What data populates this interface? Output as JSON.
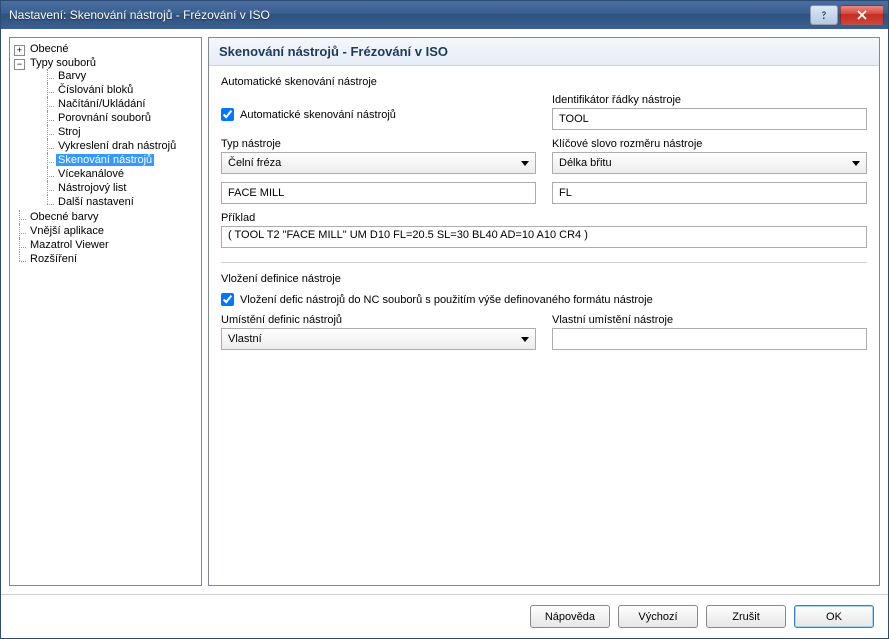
{
  "window": {
    "title": "Nastavení: Skenování nástrojů - Frézování v ISO"
  },
  "tree": {
    "obecne": "Obecné",
    "typy_souboru": "Typy souborů",
    "barvy": "Barvy",
    "cislovani": "Číslování bloků",
    "nacitani": "Načítání/Ukládání",
    "porovnani": "Porovnání souborů",
    "stroj": "Stroj",
    "vykresleni": "Vykreslení drah nástrojů",
    "skenovani": "Skenování nástrojů",
    "vicekanalove": "Vícekanálové",
    "nastrojovy_list": "Nástrojový list",
    "dalsi": "Další nastavení",
    "obecne_barvy": "Obecné barvy",
    "vnejsi": "Vnější aplikace",
    "mazatrol": "Mazatrol Viewer",
    "rozsireni": "Rozšíření"
  },
  "panel": {
    "heading": "Skenování nástrojů - Frézování v ISO",
    "group_scan": "Automatické skenování nástroje",
    "chk_scan": "Automatické skenování nástrojů",
    "ident_label": "Identifikátor řádky nástroje",
    "ident_value": "TOOL",
    "type_label": "Typ nástroje",
    "type_select": "Čelní fréza",
    "type_value": "FACE MILL",
    "keyword_label": "Klíčové slovo rozměru nástroje",
    "keyword_select": "Délka břitu",
    "keyword_value": "FL",
    "example_label": "Příklad",
    "example_value": "( TOOL T2 \"FACE MILL\" UM D10 FL=20.5 SL=30 BL40 AD=10 A10 CR4 )",
    "group_insert": "Vložení definice nástroje",
    "chk_insert": "Vložení defic nástrojů do NC souborů s použitím výše definovaného formátu nástroje",
    "loc_label": "Umístění definic nástrojů",
    "loc_select": "Vlastní",
    "custom_loc_label": "Vlastní umístění nástroje",
    "custom_loc_value": ""
  },
  "buttons": {
    "help": "Nápověda",
    "default": "Výchozí",
    "cancel": "Zrušit",
    "ok": "OK"
  }
}
